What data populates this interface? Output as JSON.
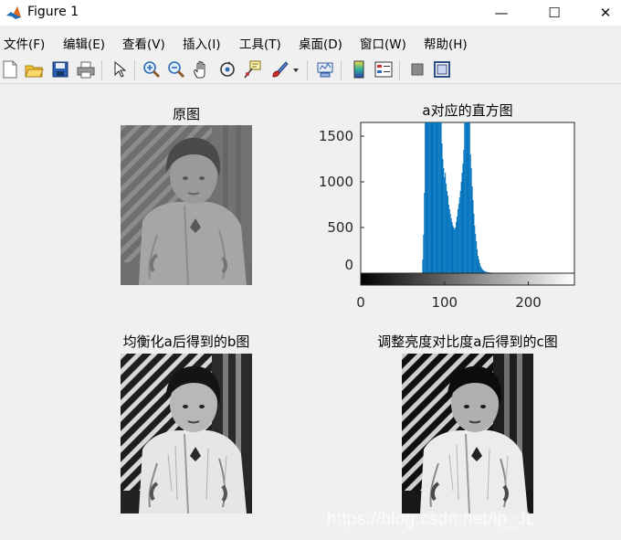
{
  "window": {
    "title": "Figure 1",
    "controls": [
      "—",
      "☐",
      "✕"
    ]
  },
  "menubar": {
    "items": [
      "文件(F)",
      "编辑(E)",
      "查看(V)",
      "插入(I)",
      "工具(T)",
      "桌面(D)",
      "窗口(W)",
      "帮助(H)"
    ]
  },
  "toolbar": {
    "icons": [
      "new-figure-icon",
      "open-file-icon",
      "save-icon",
      "print-icon",
      "edit-plot-arrow-icon",
      "zoom-in-icon",
      "zoom-out-icon",
      "pan-hand-icon",
      "rotate-3d-icon",
      "data-cursor-icon",
      "brush-icon",
      "brush-dropdown-icon",
      "link-plot-icon",
      "colorbar-icon",
      "legend-icon",
      "hide-plot-tools-icon",
      "show-plot-tools-icon"
    ]
  },
  "subplots": {
    "original": {
      "title": "原图"
    },
    "histogram": {
      "title": "a对应的直方图"
    },
    "equalized": {
      "title": "均衡化a后得到的b图"
    },
    "adjusted": {
      "title": "调整亮度对比度a后得到的c图"
    }
  },
  "watermark": "https://blog.csdn.net/lp_JL",
  "chart_data": {
    "type": "bar",
    "title": "a对应的直方图",
    "xlabel": "",
    "ylabel": "",
    "xlim": [
      0,
      255
    ],
    "ylim": [
      0,
      1650
    ],
    "xticks": [
      0,
      100,
      200
    ],
    "yticks": [
      0,
      500,
      1000,
      1500
    ],
    "bar_color": "#0072bd",
    "grid": false,
    "colorbar": "gray",
    "x": [
      74,
      75,
      76,
      77,
      78,
      79,
      80,
      81,
      82,
      83,
      84,
      85,
      86,
      87,
      88,
      89,
      90,
      91,
      92,
      93,
      94,
      95,
      96,
      97,
      98,
      99,
      100,
      101,
      102,
      103,
      104,
      105,
      106,
      107,
      108,
      109,
      110,
      111,
      112,
      113,
      114,
      115,
      116,
      117,
      118,
      119,
      120,
      121,
      122,
      123,
      124,
      125,
      126,
      127,
      128,
      129,
      130,
      131,
      132,
      133,
      134,
      135,
      136,
      137,
      138,
      139,
      140,
      141,
      142,
      143,
      144,
      145,
      146,
      147,
      148,
      149,
      150,
      151,
      152,
      153,
      154,
      155,
      156,
      157,
      158,
      159,
      160,
      161,
      162,
      163,
      164,
      165,
      166,
      167,
      168,
      169,
      170,
      171,
      172,
      173,
      174,
      175,
      176,
      177,
      178,
      179,
      180,
      181,
      182,
      183,
      184,
      185
    ],
    "values": [
      150,
      420,
      880,
      1650,
      1650,
      1650,
      1650,
      1650,
      1650,
      1650,
      1650,
      1650,
      1650,
      1650,
      1650,
      1650,
      1650,
      1650,
      1650,
      1650,
      1650,
      1650,
      1650,
      1420,
      1250,
      1150,
      1050,
      1100,
      980,
      900,
      850,
      750,
      700,
      650,
      600,
      560,
      520,
      500,
      480,
      500,
      560,
      620,
      700,
      760,
      830,
      900,
      1000,
      1100,
      1200,
      1350,
      1650,
      1650,
      1650,
      1650,
      1650,
      1650,
      1650,
      1300,
      1150,
      950,
      800,
      650,
      520,
      430,
      350,
      260,
      190,
      150,
      110,
      80,
      60,
      45,
      35,
      28,
      22,
      18,
      14,
      12,
      10,
      9,
      8,
      7,
      6,
      5,
      5,
      4,
      4,
      3,
      3,
      3,
      2,
      2,
      2,
      2,
      2,
      1,
      1,
      1,
      1,
      1,
      1,
      1,
      1,
      1,
      1,
      1,
      1,
      1,
      1,
      1,
      1,
      1
    ]
  }
}
